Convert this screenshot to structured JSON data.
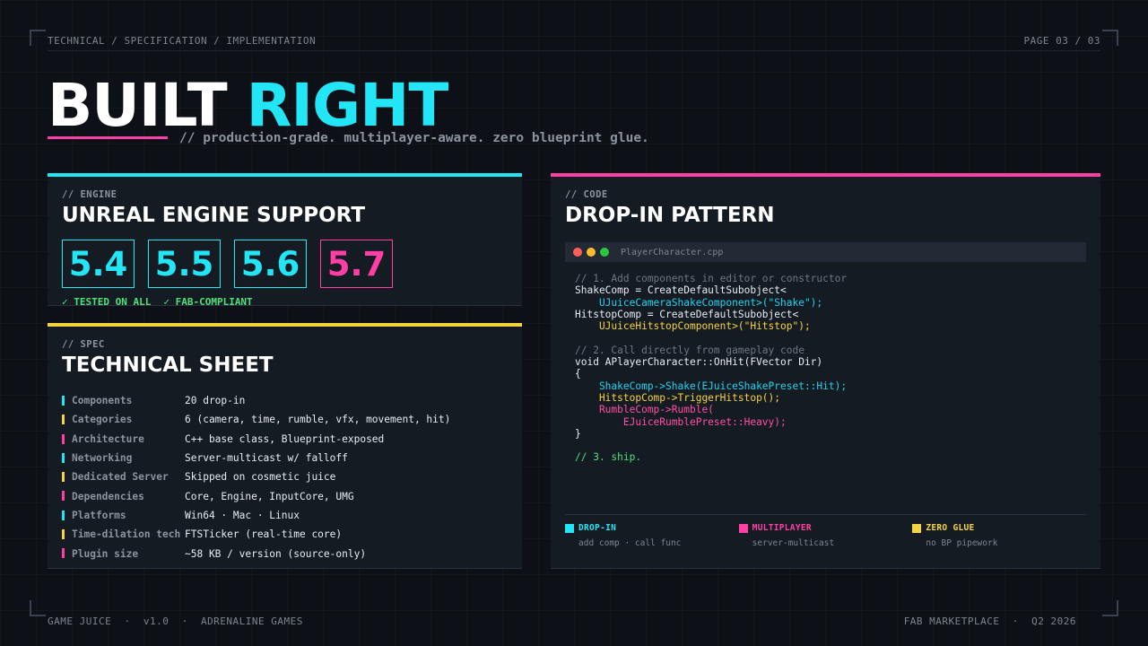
{
  "header": {
    "breadcrumb": "TECHNICAL / SPECIFICATION / IMPLEMENTATION",
    "page_indicator": "PAGE 03 / 03"
  },
  "hero": {
    "title_part1": "BUILT",
    "title_part2": "RIGHT",
    "tagline": "// production-grade. multiplayer-aware. zero blueprint glue."
  },
  "engine_panel": {
    "label": "// ENGINE",
    "heading": "UNREAL ENGINE SUPPORT",
    "versions": [
      "5.4",
      "5.5",
      "5.6",
      "5.7"
    ],
    "checks": [
      "✓ TESTED ON ALL",
      "✓ FAB-COMPLIANT"
    ]
  },
  "spec_panel": {
    "label": "// SPEC",
    "heading": "TECHNICAL SHEET",
    "rows": [
      {
        "key": "Components",
        "value": "20 drop-in",
        "color": "#22e5f5"
      },
      {
        "key": "Categories",
        "value": "6 (camera, time, rumble, vfx, movement, hit)",
        "color": "#f5d33a"
      },
      {
        "key": "Architecture",
        "value": "C++ base class, Blueprint-exposed",
        "color": "#ff3fa4"
      },
      {
        "key": "Networking",
        "value": "Server-multicast w/ falloff",
        "color": "#22e5f5"
      },
      {
        "key": "Dedicated Server",
        "value": "Skipped on cosmetic juice",
        "color": "#f5d33a"
      },
      {
        "key": "Dependencies",
        "value": "Core, Engine, InputCore, UMG",
        "color": "#ff3fa4"
      },
      {
        "key": "Platforms",
        "value": "Win64 · Mac · Linux",
        "color": "#22e5f5"
      },
      {
        "key": "Time-dilation tech",
        "value": "FTSTicker (real-time core)",
        "color": "#f5d33a"
      },
      {
        "key": "Plugin size",
        "value": "~58 KB / version (source-only)",
        "color": "#ff3fa4"
      }
    ]
  },
  "code_panel": {
    "label": "// CODE",
    "heading": "DROP-IN PATTERN",
    "filename": "PlayerCharacter.cpp",
    "lines": [
      {
        "text": "// 1. Add components in editor or constructor",
        "style": "comment"
      },
      {
        "text": "ShakeComp = CreateDefaultSubobject<",
        "style": "plain"
      },
      {
        "text": "    UJuiceCameraShakeComponent>(\"Shake\");",
        "style": "cyan"
      },
      {
        "text": "HitstopComp = CreateDefaultSubobject<",
        "style": "plain"
      },
      {
        "text": "    UJuiceHitstopComponent>(\"Hitstop\");",
        "style": "yellow"
      },
      {
        "text": "",
        "style": "plain"
      },
      {
        "text": "// 2. Call directly from gameplay code",
        "style": "comment"
      },
      {
        "text": "void APlayerCharacter::OnHit(FVector Dir)",
        "style": "plain"
      },
      {
        "text": "{",
        "style": "plain"
      },
      {
        "text": "    ShakeComp->Shake(EJuiceShakePreset::Hit);",
        "style": "cyan"
      },
      {
        "text": "    HitstopComp->TriggerHitstop();",
        "style": "yellow"
      },
      {
        "text": "    RumbleComp->Rumble(",
        "style": "pink"
      },
      {
        "text": "        EJuiceRumblePreset::Heavy);",
        "style": "pink"
      },
      {
        "text": "}",
        "style": "plain"
      },
      {
        "text": "",
        "style": "plain"
      },
      {
        "text": "// 3. ship.",
        "style": "green"
      }
    ],
    "features": [
      {
        "title": "DROP-IN",
        "sub": "add comp · call func",
        "color": "#22e5f5"
      },
      {
        "title": "MULTIPLAYER",
        "sub": "server-multicast",
        "color": "#ff3fa4"
      },
      {
        "title": "ZERO GLUE",
        "sub": "no BP pipework",
        "color": "#f5d33a"
      }
    ],
    "dot_colors": [
      "#ff5f57",
      "#febc2e",
      "#28c840"
    ]
  },
  "footer": {
    "left": "GAME JUICE  ·  v1.0  ·  ADRENALINE GAMES",
    "right": "FAB MARKETPLACE  ·  Q2 2026"
  },
  "colors": {
    "cyan": "#22e5f5",
    "pink": "#ff3fa4",
    "yellow": "#f5d33a",
    "green": "#4ee07a",
    "background": "#0d1117"
  }
}
